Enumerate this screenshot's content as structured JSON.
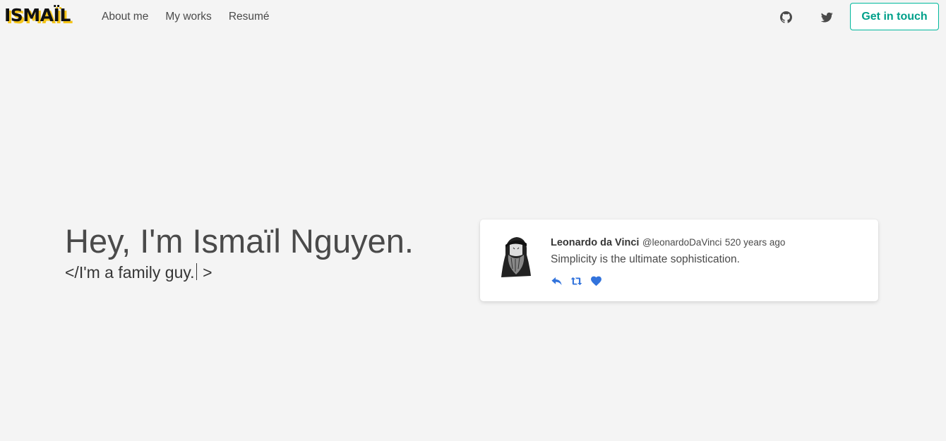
{
  "nav": {
    "logo": "ISMAÏL",
    "links": [
      "About me",
      "My works",
      "Resumé"
    ],
    "icons": [
      "github-icon",
      "twitter-icon"
    ],
    "cta": "Get in touch"
  },
  "hero": {
    "title": "Hey, I'm Ismaïl Nguyen.",
    "subtitle_prefix": "</",
    "subtitle_text": "I'm a family guy.",
    "subtitle_suffix": ">"
  },
  "tweet": {
    "name": "Leonardo da Vinci",
    "handle": "@leonardoDaVinci",
    "time": "520 years ago",
    "text": "Simplicity is the ultimate sophistication.",
    "actions": [
      "reply-icon",
      "retweet-icon",
      "like-icon"
    ]
  },
  "colors": {
    "background": "#f4f4f4",
    "accent": "#00b89c",
    "logo_highlight": "#f5c518",
    "tweet_action": "#3273dc"
  }
}
